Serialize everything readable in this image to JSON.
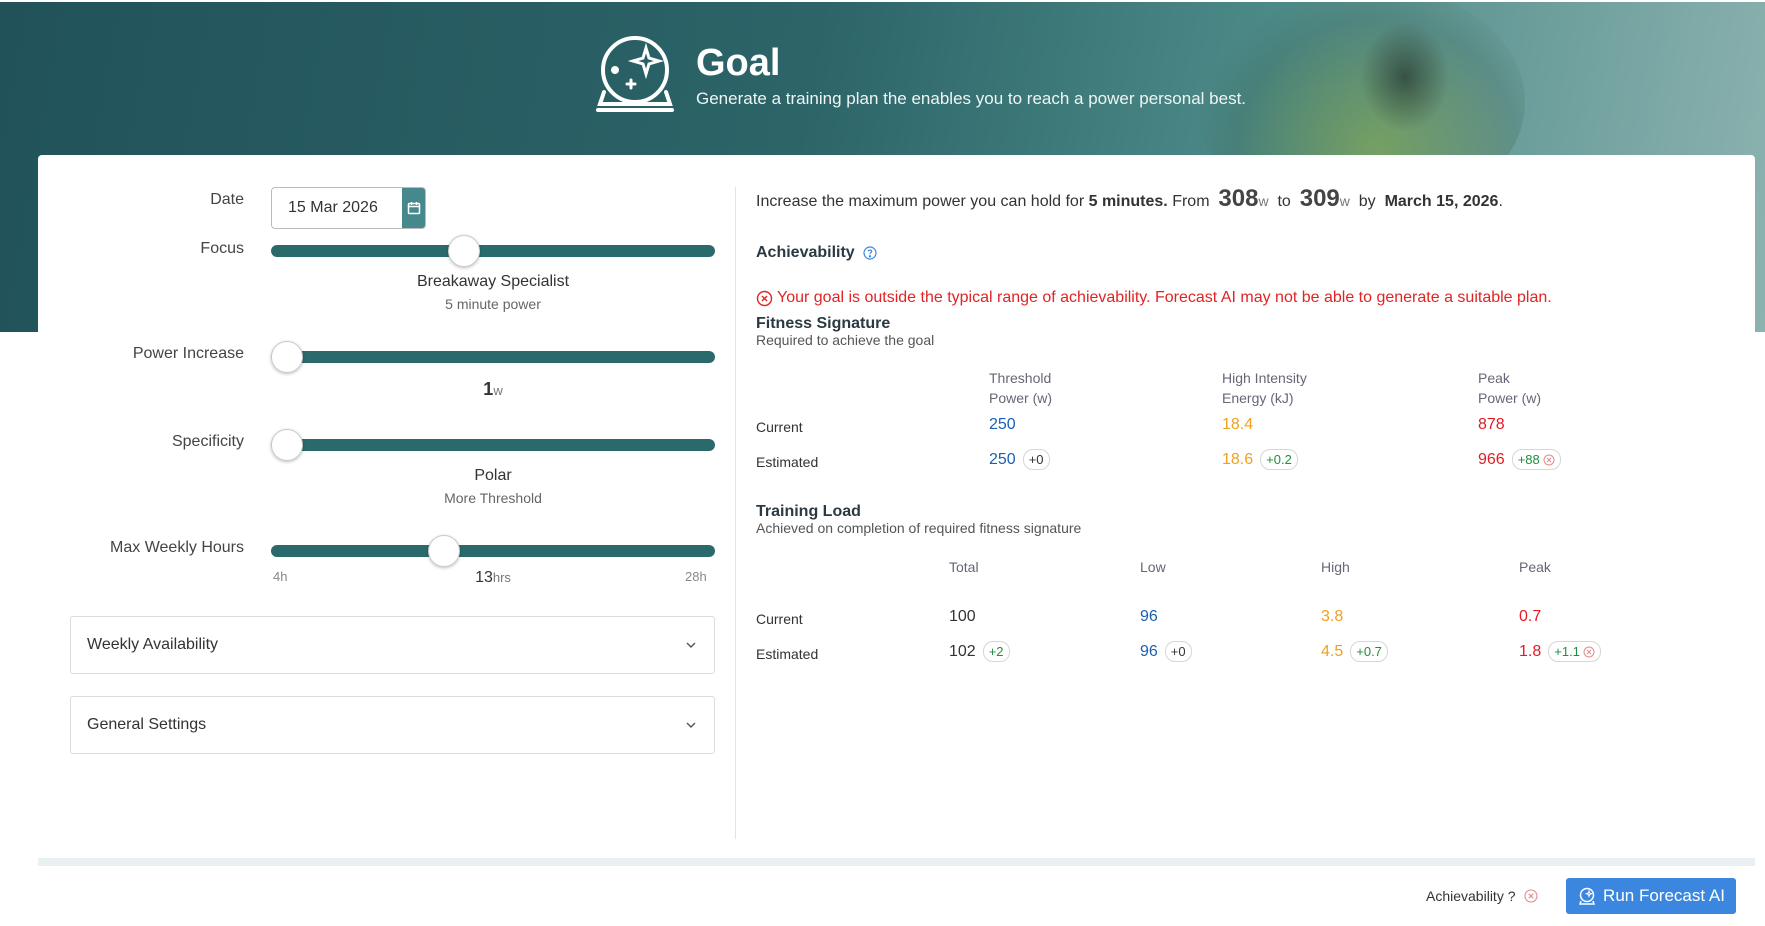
{
  "header": {
    "title": "Goal",
    "subtitle": "Generate a training plan the enables you to reach a power personal best.",
    "icon": "crystal-ball-icon"
  },
  "form": {
    "date": {
      "label": "Date",
      "value": "15 Mar 2026"
    },
    "focus": {
      "label": "Focus",
      "level": 0.43,
      "value": "Breakaway Specialist",
      "sub": "5 minute power"
    },
    "power_increase": {
      "label": "Power Increase",
      "level": 0.0,
      "value": "1",
      "unit": "w"
    },
    "specificity": {
      "label": "Specificity",
      "level": 0.0,
      "value": "Polar",
      "sub": "More Threshold"
    },
    "max_weekly_hours": {
      "label": "Max Weekly Hours",
      "level": 0.38,
      "min": "4h",
      "max": "28h",
      "value": "13",
      "unit": "hrs"
    },
    "weekly_availability": "Weekly Availability",
    "general_settings": "General Settings"
  },
  "goal_summary": {
    "prefix": "Increase the maximum power you can hold for",
    "duration": "5 minutes.",
    "from_word": "From",
    "from_value": "308",
    "to_word": "to",
    "to_value": "309",
    "unit": "w",
    "by_word": "by",
    "date": "March 15, 2026",
    "period": "."
  },
  "achievability": {
    "title": "Achievability",
    "message": "Your goal is outside the typical range of achievability. Forecast AI may not be able to generate a suitable plan."
  },
  "fitness_signature": {
    "title": "Fitness Signature",
    "subtitle": "Required to achieve the goal",
    "columns": [
      {
        "line1": "Threshold",
        "line2": "Power (w)"
      },
      {
        "line1": "High Intensity",
        "line2": "Energy (kJ)"
      },
      {
        "line1": "Peak",
        "line2": "Power (w)"
      }
    ],
    "rows": [
      {
        "label": "Current",
        "values": [
          "250",
          "18.4",
          "878"
        ],
        "deltas": []
      },
      {
        "label": "Estimated",
        "values": [
          "250",
          "18.6",
          "966"
        ],
        "deltas": [
          "+0",
          "+0.2",
          "+88"
        ]
      }
    ]
  },
  "training_load": {
    "title": "Training Load",
    "subtitle": "Achieved on completion of required fitness signature",
    "columns": [
      "Total",
      "Low",
      "High",
      "Peak"
    ],
    "rows": [
      {
        "label": "Current",
        "values": [
          "100",
          "96",
          "3.8",
          "0.7"
        ],
        "deltas": []
      },
      {
        "label": "Estimated",
        "values": [
          "102",
          "96",
          "4.5",
          "1.8"
        ],
        "deltas": [
          "+2",
          "+0",
          "+0.7",
          "+1.1"
        ]
      }
    ]
  },
  "footer": {
    "achievability_label": "Achievability ?",
    "run_button": "Run Forecast AI"
  },
  "colors": {
    "teal": "#2b6a6c",
    "blue": "#1a5fb4",
    "orange": "#f0a020",
    "red": "#e31b23",
    "button": "#3b87e0"
  }
}
